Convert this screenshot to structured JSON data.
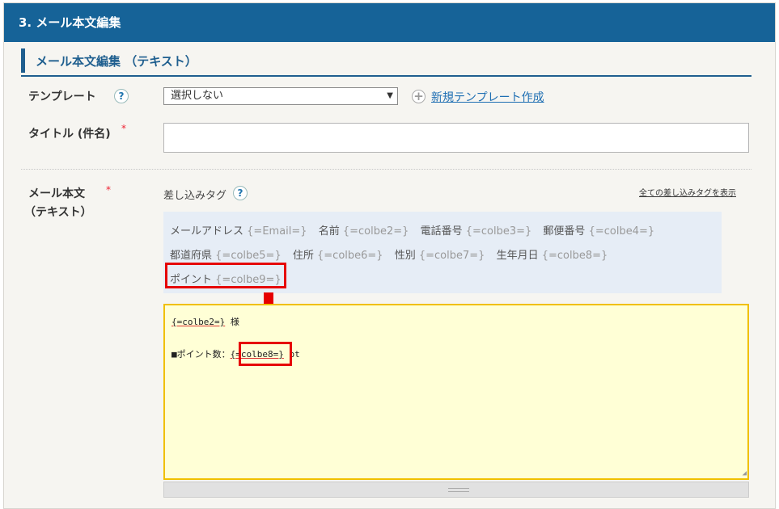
{
  "section": {
    "title": "3. メール本文編集"
  },
  "subsection": {
    "title": "メール本文編集 （テキスト）"
  },
  "template": {
    "label": "テンプレート",
    "help": "?",
    "selected": "選択しない",
    "new_link": "新規テンプレート作成"
  },
  "title_field": {
    "label": "タイトル (件名)",
    "required_mark": "*",
    "value": ""
  },
  "body_field": {
    "label_line1": "メール本文",
    "label_line2": "（テキスト）",
    "required_mark": "*",
    "tags_caption": "差し込みタグ",
    "help": "?",
    "show_all_link": "全ての差し込みタグを表示",
    "tag_rows": [
      [
        {
          "name": "メールアドレス",
          "code": "{=Email=}"
        },
        {
          "name": "名前",
          "code": "{=colbe2=}"
        },
        {
          "name": "電話番号",
          "code": "{=colbe3=}"
        },
        {
          "name": "郵便番号",
          "code": "{=colbe4=}"
        }
      ],
      [
        {
          "name": "都道府県",
          "code": "{=colbe5=}"
        },
        {
          "name": "住所",
          "code": "{=colbe6=}"
        },
        {
          "name": "性別",
          "code": "{=colbe7=}"
        },
        {
          "name": "生年月日",
          "code": "{=colbe8=}"
        }
      ],
      [
        {
          "name": "ポイント",
          "code": "{=colbe9=}"
        }
      ]
    ],
    "editor": {
      "line1_code": "{=colbe2=}",
      "line1_suffix": " 様",
      "line2_prefix": "■ポイント数：",
      "line2_code": "{=colbe8=}",
      "line2_suffix": " pt"
    }
  },
  "colors": {
    "header_bg": "#166398",
    "accent": "#1f5f8f",
    "highlight": "#e60000",
    "editor_bg": "#ffffd6",
    "tags_bg": "#e6edf6"
  }
}
